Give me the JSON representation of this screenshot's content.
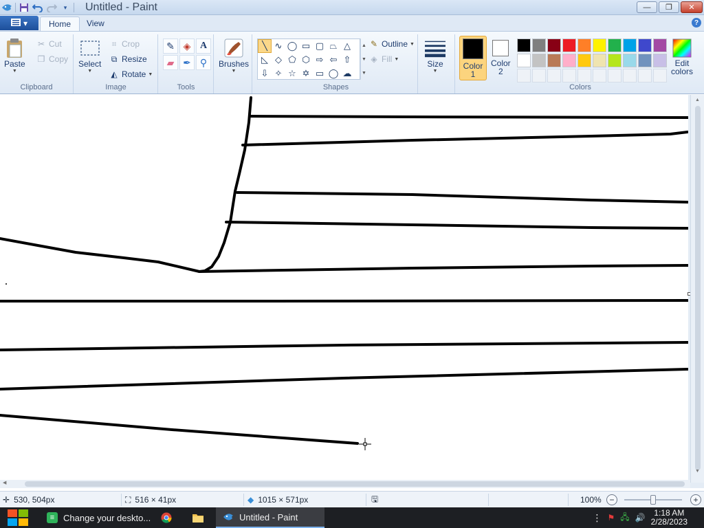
{
  "window": {
    "title": "Untitled - Paint",
    "controls": {
      "minimize": "▭",
      "maximize": "❐",
      "close": "✕"
    }
  },
  "quick_access": [
    "paint-icon",
    "save-icon",
    "undo-icon",
    "redo-icon",
    "customize-dropdown-icon"
  ],
  "tabs": {
    "file": "▾",
    "home": "Home",
    "view": "View",
    "help": "?"
  },
  "ribbon": {
    "clipboard": {
      "label": "Clipboard",
      "paste": "Paste",
      "cut": "Cut",
      "copy": "Copy"
    },
    "image": {
      "label": "Image",
      "select": "Select",
      "crop": "Crop",
      "resize": "Resize",
      "rotate": "Rotate"
    },
    "tools": {
      "label": "Tools",
      "items": [
        "pencil-icon",
        "fill-icon",
        "text-icon",
        "eraser-icon",
        "color-picker-icon",
        "magnifier-icon"
      ]
    },
    "brushes": {
      "label": "Brushes"
    },
    "shapes": {
      "label": "Shapes",
      "outline": "Outline",
      "fill": "Fill",
      "items": [
        "line",
        "curve",
        "oval",
        "rectangle",
        "rounded-rectangle",
        "polygon",
        "triangle",
        "right-triangle",
        "diamond",
        "pentagon",
        "hexagon",
        "right-arrow",
        "left-arrow",
        "up-arrow",
        "down-arrow",
        "four-point-star",
        "five-point-star",
        "six-point-star",
        "rounded-callout",
        "oval-callout",
        "cloud-callout"
      ],
      "selected": "line"
    },
    "size": {
      "label": "Size"
    },
    "colors": {
      "label": "Colors",
      "color1_label": "Color\n1",
      "color1_line1": "Color",
      "color1_line2": "1",
      "color2_line1": "Color",
      "color2_line2": "2",
      "color1": "#000000",
      "color2": "#ffffff",
      "edit": "Edit colors",
      "edit_line1": "Edit",
      "edit_line2": "colors",
      "palette_row1": [
        "#000000",
        "#7f7f7f",
        "#880015",
        "#ed1c24",
        "#ff7f27",
        "#fff200",
        "#22b14c",
        "#00a2e8",
        "#3f48cc",
        "#a349a4"
      ],
      "palette_row2": [
        "#ffffff",
        "#c3c3c3",
        "#b97a57",
        "#ffaec9",
        "#ffc90e",
        "#efe4b0",
        "#b5e61d",
        "#99d9ea",
        "#7092be",
        "#c8bfe7"
      ]
    }
  },
  "canvas": {
    "cursor_icon": "crosshair-icon"
  },
  "status": {
    "cursor_pos": "530, 504px",
    "selection_size": "516 × 41px",
    "image_size": "1015 × 571px",
    "zoom": "100%"
  },
  "taskbar": {
    "start": "windows-start-icon",
    "tasks": [
      {
        "label": "Change your deskto...",
        "icon": "settings-app-icon"
      },
      {
        "label": "",
        "icon": "chrome-icon"
      },
      {
        "label": "",
        "icon": "file-explorer-icon"
      },
      {
        "label": "Untitled - Paint",
        "icon": "paint-icon"
      }
    ],
    "clock_time": "1:18 AM",
    "clock_date": "2/28/2023"
  }
}
